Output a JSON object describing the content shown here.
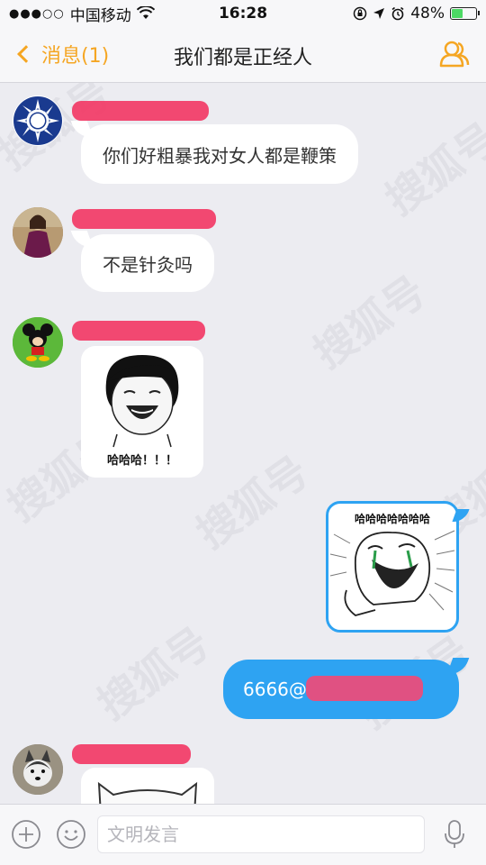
{
  "status_bar": {
    "carrier": "中国移动",
    "time": "16:28",
    "battery": "48%",
    "battery_level": 0.48
  },
  "nav": {
    "back_label": "消息(1)",
    "title": "我们都是正经人"
  },
  "messages": [
    {
      "type": "text",
      "direction": "in",
      "text": "你们好粗暴我对女人都是鞭策"
    },
    {
      "type": "text",
      "direction": "in",
      "text": "不是针灸吗"
    },
    {
      "type": "image",
      "direction": "in",
      "caption": "哈哈哈！！！"
    },
    {
      "type": "image",
      "direction": "out",
      "caption": "哈哈哈哈哈哈哈"
    },
    {
      "type": "text",
      "direction": "out",
      "text": "6666@"
    }
  ],
  "input": {
    "placeholder": "文明发言"
  },
  "watermark": "搜狐号"
}
